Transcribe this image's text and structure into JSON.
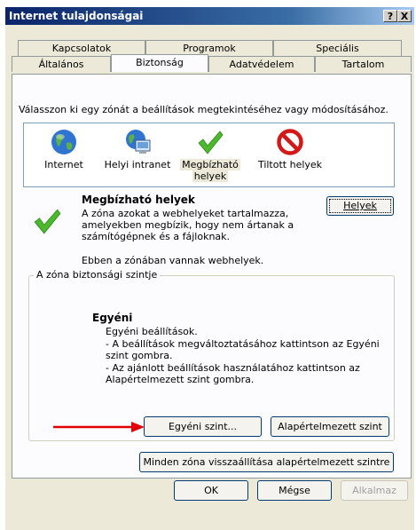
{
  "window": {
    "title": "Internet tulajdonságai",
    "help_btn": "?",
    "close_btn": "X"
  },
  "tabs_top": [
    "Kapcsolatok",
    "Programok",
    "Speciális"
  ],
  "tabs_bottom": [
    "Általános",
    "Biztonság",
    "Adatvédelem",
    "Tartalom"
  ],
  "instruction": "Válasszon ki egy zónát a beállítások megtekintéséhez vagy módosításához.",
  "zones": [
    {
      "label": "Internet",
      "icon": "globe-icon"
    },
    {
      "label": "Helyi intranet",
      "icon": "intranet-icon"
    },
    {
      "label_line1": "Megbízható",
      "label_line2": "helyek",
      "icon": "checkmark-icon"
    },
    {
      "label": "Tiltott helyek",
      "icon": "restricted-icon"
    }
  ],
  "zone_info": {
    "title": "Megbízható helyek",
    "desc_line1": "A zóna azokat a webhelyeket tartalmazza,",
    "desc_line2": "amelyekben megbízik, hogy nem ártanak a",
    "desc_line3": "számítógépnek és a fájloknak.",
    "sites_text": "Ebben a zónában vannak webhelyek.",
    "sites_button": "Helyek"
  },
  "security_level": {
    "group_label": "A zóna biztonsági szintje",
    "level_title": "Egyéni",
    "lines": [
      "Egyéni beállítások.",
      "- A beállítások megváltoztatásához kattintson az Egyéni",
      "szint gombra.",
      "- Az ajánlott beállítások használatához kattintson az",
      "Alapértelmezett szint gombra."
    ],
    "custom_button": "Egyéni szint...",
    "default_button": "Alapértelmezett szint"
  },
  "reset_all_button": "Minden zóna visszaállítása alapértelmezett szintre",
  "footer": {
    "ok": "OK",
    "cancel": "Mégse",
    "apply": "Alkalmaz"
  },
  "colors": {
    "title_bar": "#0a246a",
    "dialog_bg": "#ece9d8",
    "panel_bg": "#fcfcfe",
    "arrow": "#e00000",
    "check": "#4cb82c"
  }
}
